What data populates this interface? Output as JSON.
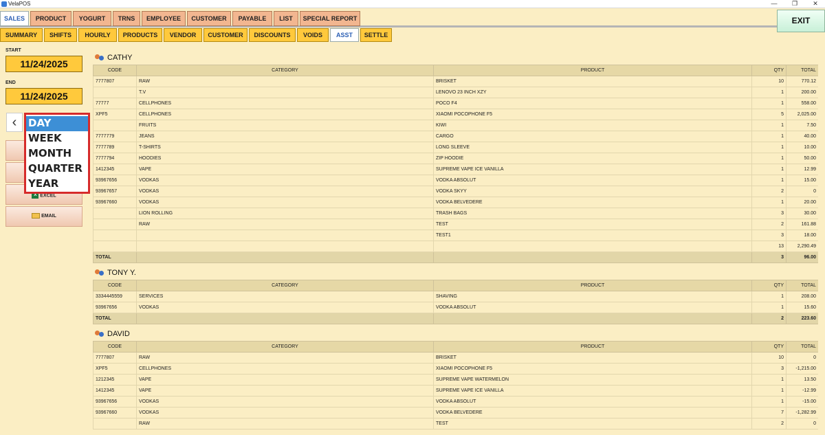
{
  "window": {
    "title": "VelaPOS",
    "minimize": "—",
    "maximize": "❐",
    "close": "✕"
  },
  "main_tabs": [
    "SALES",
    "PRODUCT",
    "YOGURT",
    "TRNS",
    "EMPLOYEE",
    "CUSTOMER",
    "PAYABLE",
    "LIST",
    "SPECIAL REPORT"
  ],
  "exit_label": "EXIT",
  "sub_tabs": [
    "SUMMARY",
    "SHIFTS",
    "HOURLY",
    "PRODUCTS",
    "VENDOR",
    "CUSTOMER",
    "DISCOUNTS",
    "VOIDS",
    "ASST",
    "SETTLE"
  ],
  "left": {
    "start_label": "START",
    "start_date": "11/24/2025",
    "end_label": "END",
    "end_date": "11/24/2025",
    "prev_label": "‹",
    "period_options": [
      "DAY",
      "WEEK",
      "MONTH",
      "QUARTER",
      "YEAR"
    ],
    "selected_period": "DAY",
    "excel_label": "EXCEL",
    "email_label": "EMAIL"
  },
  "columns": {
    "code": "CODE",
    "category": "CATEGORY",
    "product": "PRODUCT",
    "qty": "QTY",
    "total": "TOTAL"
  },
  "total_label": "TOTAL",
  "employees": [
    {
      "name": "CATHY",
      "rows": [
        [
          "7777807",
          "RAW",
          "BRISKET",
          "10",
          "770.12"
        ],
        [
          "",
          "T.V",
          "LENOVO 23 INCH XZY",
          "1",
          "200.00"
        ],
        [
          "77777",
          "CELLPHONES",
          "POCO F4",
          "1",
          "558.00"
        ],
        [
          "XPF5",
          "CELLPHONES",
          "XIAOMI POCOPHONE F5",
          "5",
          "2,025.00"
        ],
        [
          "",
          "FRUITS",
          "KIWI",
          "1",
          "7.50"
        ],
        [
          "7777779",
          "JEANS",
          "CARGO",
          "1",
          "40.00"
        ],
        [
          "7777789",
          "T-SHIRTS",
          "LONG SLEEVE",
          "1",
          "10.00"
        ],
        [
          "7777794",
          "HOODIES",
          "ZIP HOODIE",
          "1",
          "50.00"
        ],
        [
          "1412345",
          "VAPE",
          "SUPREME VAPE ICE VANILLA",
          "1",
          "12.99"
        ],
        [
          "93967656",
          "VODKAS",
          "VODKA ABSOLUT",
          "1",
          "15.00"
        ],
        [
          "93967657",
          "VODKAS",
          "VODKA SKYY",
          "2",
          "0"
        ],
        [
          "93967660",
          "VODKAS",
          "VODKA BELVEDERE",
          "1",
          "20.00"
        ],
        [
          "",
          "LION ROLLING",
          "TRASH BAGS",
          "3",
          "30.00"
        ],
        [
          "",
          "RAW",
          "TEST",
          "2",
          "161.88"
        ],
        [
          "",
          "",
          "TEST1",
          "3",
          "18.00"
        ]
      ],
      "subtotal": {
        "qty": "13",
        "total": "2,290.49"
      },
      "total": {
        "qty": "3",
        "total": "96.00"
      }
    },
    {
      "name": "TONY Y.",
      "rows": [
        [
          "3334445559",
          "SERVICES",
          "SHAVING",
          "1",
          "208.00"
        ],
        [
          "93967656",
          "VODKAS",
          "VODKA ABSOLUT",
          "1",
          "15.60"
        ]
      ],
      "total": {
        "qty": "2",
        "total": "223.60"
      }
    },
    {
      "name": "DAVID",
      "rows": [
        [
          "7777807",
          "RAW",
          "BRISKET",
          "10",
          "0"
        ],
        [
          "XPF5",
          "CELLPHONES",
          "XIAOMI POCOPHONE F5",
          "3",
          "-1,215.00"
        ],
        [
          "1212345",
          "VAPE",
          "SUPREME VAPE WATERMELON",
          "1",
          "13.50"
        ],
        [
          "1412345",
          "VAPE",
          "SUPREME VAPE ICE VANILLA",
          "1",
          "-12.99"
        ],
        [
          "93967656",
          "VODKAS",
          "VODKA ABSOLUT",
          "1",
          "-15.00"
        ],
        [
          "93967660",
          "VODKAS",
          "VODKA BELVEDERE",
          "7",
          "-1,282.99"
        ],
        [
          "",
          "RAW",
          "TEST",
          "2",
          "0"
        ]
      ]
    }
  ]
}
